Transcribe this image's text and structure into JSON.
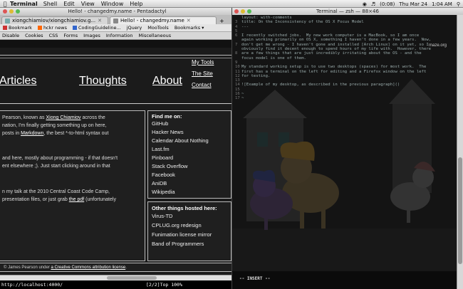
{
  "menubar": {
    "app": "Terminal",
    "items": [
      "Shell",
      "Edit",
      "View",
      "Window",
      "Help"
    ],
    "right": [
      "(0:08)",
      "Thu Mar 24",
      "1:04 AM"
    ]
  },
  "browser": {
    "title": "Hello! - changedmy.name - Pentadactyl",
    "tabs": [
      {
        "label": "xiongchiamiov/xiongchiamiov.g..."
      },
      {
        "label": "Hello! - changedmy.name"
      }
    ],
    "bookmarks": [
      "Bookmark",
      "hckr news",
      "CodingGuideline...",
      "jQuery",
      "MooTools",
      "Bookmarks"
    ],
    "devbar": [
      "Disable",
      "Cookies",
      "CSS",
      "Forms",
      "Images",
      "Information",
      "Miscellaneous"
    ],
    "page": {
      "nav": [
        "Articles",
        "Thoughts",
        "About"
      ],
      "nav_small": [
        "My Tools",
        "The Site",
        "Contact"
      ],
      "main_lines": [
        {
          "pre": "Pearson, known as ",
          "link": "Xiong Chiamiov",
          "post": " across the"
        },
        {
          "pre": "nation, I'm finally getting something up on here,",
          "link": "",
          "post": ""
        },
        {
          "pre": "posts in ",
          "link": "Markdown",
          "post": ", the best *-to-html syntax out"
        },
        {
          "pre": "",
          "link": "",
          "post": ""
        },
        {
          "pre": "",
          "link": "",
          "post": ""
        },
        {
          "pre": "and here, mostly about programming - if that doesn't",
          "link": "",
          "post": ""
        },
        {
          "pre": "ent elsewhere ;). Just start clicking around in that",
          "link": "",
          "post": ""
        },
        {
          "pre": "",
          "link": "",
          "post": ""
        },
        {
          "pre": "",
          "link": "",
          "post": ""
        },
        {
          "pre": "n my talk at the 2010 Central Coast Code Camp,",
          "link": "",
          "post": ""
        },
        {
          "pre": "presentation files, or just grab ",
          "link": "the pdf",
          "post": " (unfortunately"
        }
      ],
      "find_me_heading": "Find me on:",
      "find_me": [
        "GitHub",
        "Hacker News",
        "Calendar About Nothing",
        "Last.fm",
        "Pinboard",
        "Stack Overflow",
        "Facebook",
        "AniDB",
        "Wikipedia"
      ],
      "other_heading": "Other things hosted here:",
      "other": [
        "Virus-TD",
        "CPLUG.org redesign",
        "Funimation license mirror",
        "Band of Programmers"
      ],
      "footer_pre": "© James Pearson under ",
      "footer_link": "a Creative Commons attribution license",
      "footer_post": "."
    },
    "status_left": "http://localhost:4000/",
    "status_right": "[2/2]Top  100%"
  },
  "terminal": {
    "title": "Terminal — zsh — 88×46",
    "watermark": "maze.org",
    "lines": [
      {
        "n": "",
        "t": "layout: with-comments"
      },
      {
        "n": "3",
        "t": "title: On the Inconsistency of the OS X Focus Model"
      },
      {
        "n": "4",
        "t": "---"
      },
      {
        "n": "5",
        "t": ""
      },
      {
        "n": "6",
        "t": "I recently switched jobs.  My new work computer is a MacBook, so I am once"
      },
      {
        "n": "",
        "t": "again working primarily on OS X, something I haven't done in a few years.  Now,"
      },
      {
        "n": "7",
        "t": "don't get me wrong - I haven't gone and installed [Arch Linux] on it yet, so I"
      },
      {
        "n": "",
        "t": "obviously find it decent enough to spend hours of my life with.  However, there"
      },
      {
        "n": "8",
        "t": "are a few things that are just incredibly irritating about the OS - and the"
      },
      {
        "n": "",
        "t": "focus model is one of them."
      },
      {
        "n": "9",
        "t": ""
      },
      {
        "n": "10",
        "t": "My standard working setup is to use two desktops (spaces) for most work.  The"
      },
      {
        "n": "11",
        "t": "first has a terminal on the left for editing and a Firefox window on the left"
      },
      {
        "n": "12",
        "t": "for testing."
      },
      {
        "n": "13",
        "t": ""
      },
      {
        "n": "14",
        "t": "![Example of my desktop, as described in the previous paragraph]()"
      },
      {
        "n": "15",
        "t": ""
      },
      {
        "n": "16",
        "t": "~"
      },
      {
        "n": "17",
        "t": "~"
      }
    ],
    "mode": "-- INSERT --"
  },
  "colors": {
    "page_bg": "#1b1b1b",
    "term_bg": "#0b0b0b",
    "menubar": "#e6e6e6"
  }
}
